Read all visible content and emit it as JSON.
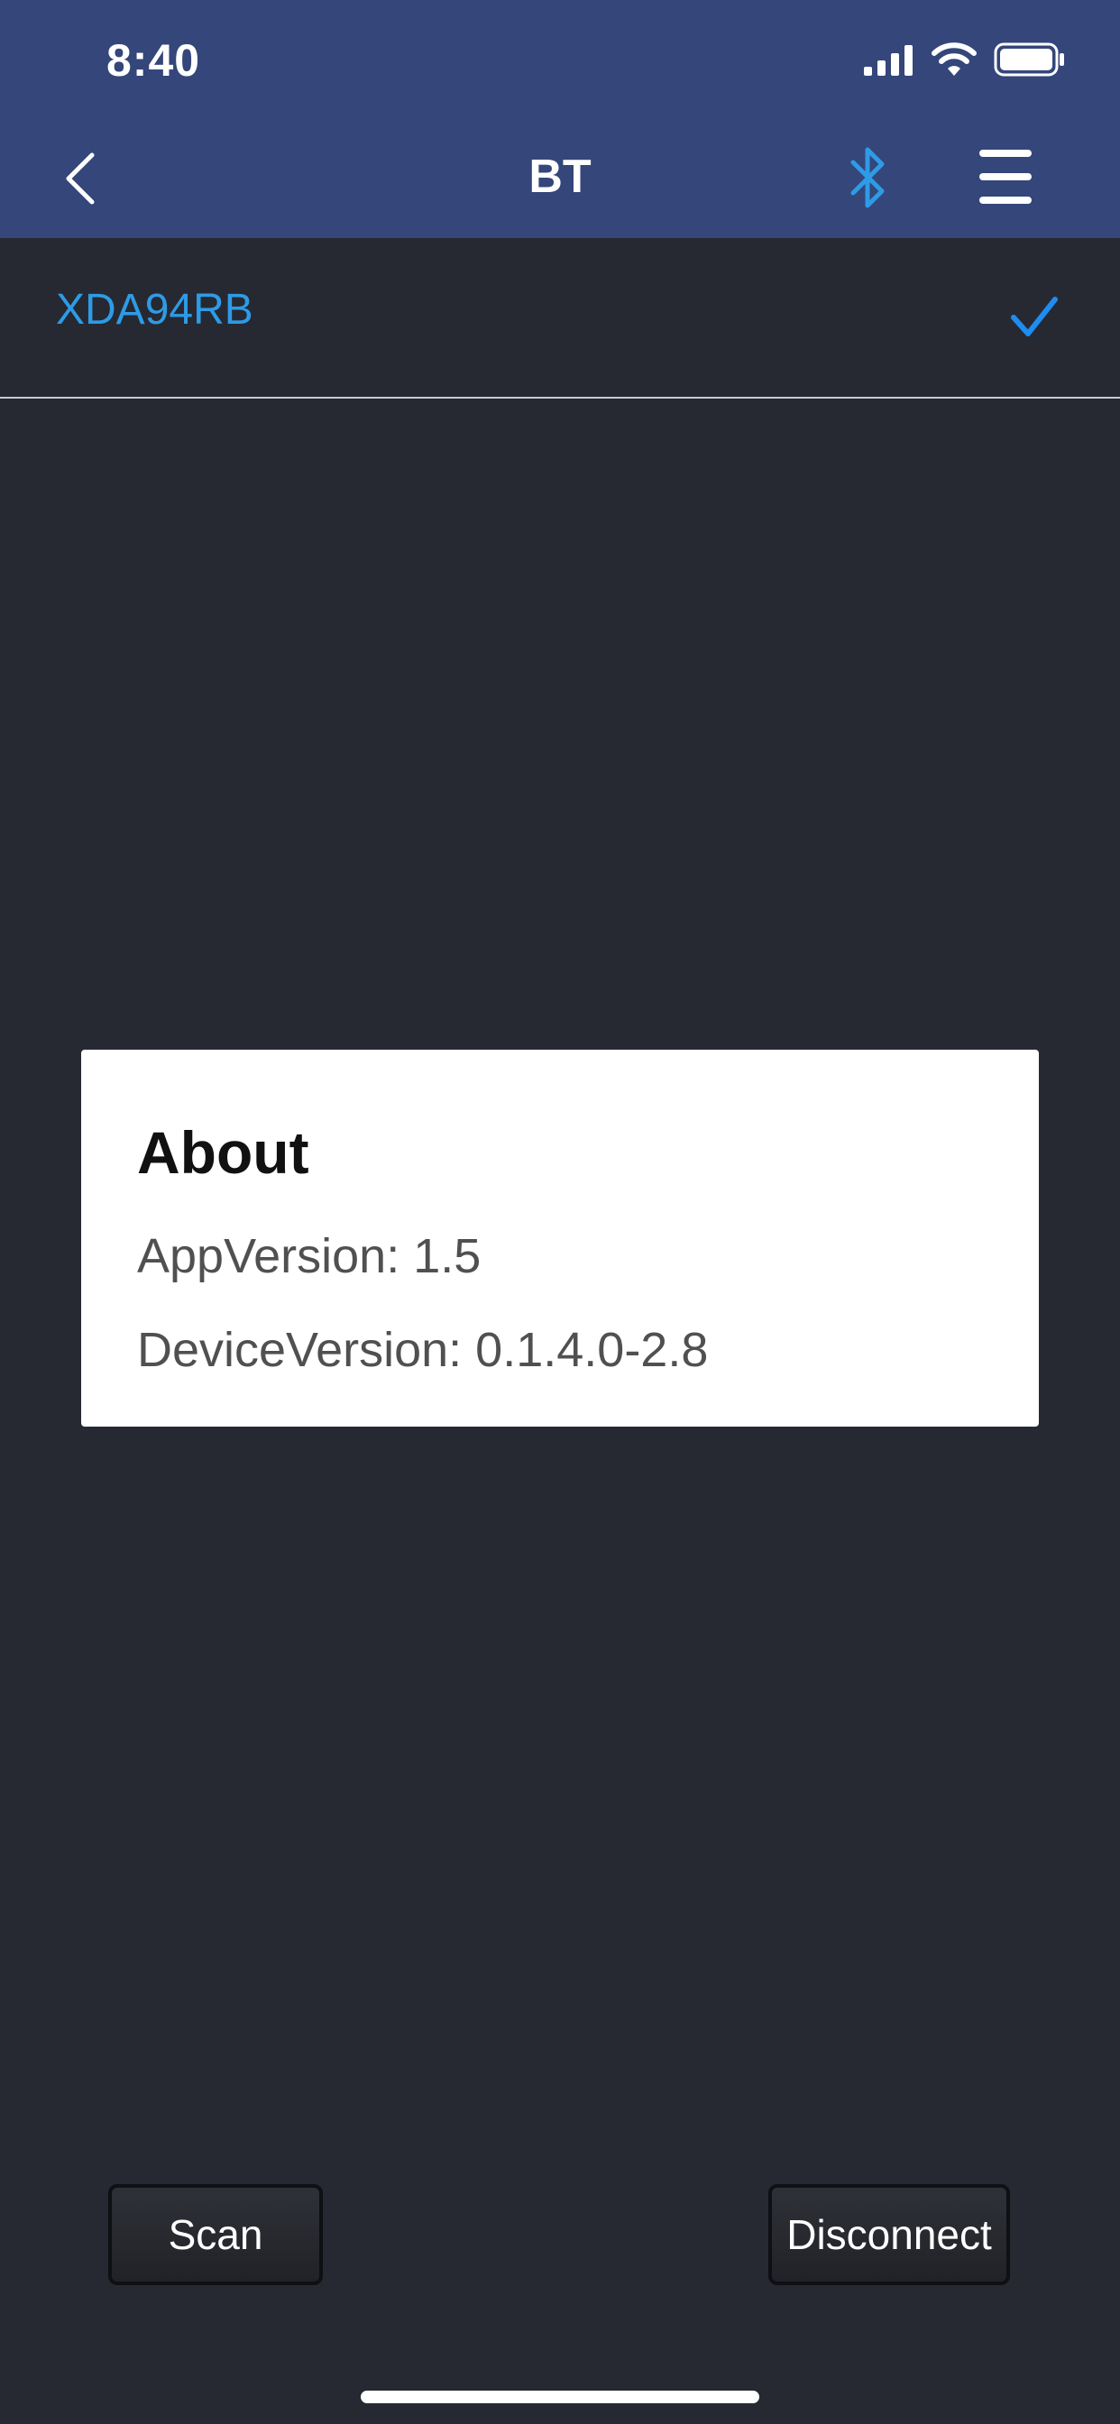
{
  "status_bar": {
    "time": "8:40"
  },
  "nav": {
    "title": "BT",
    "back_icon": "chevron-left-icon",
    "bluetooth_icon": "bluetooth-icon",
    "menu_icon": "hamburger-menu-icon"
  },
  "devices": [
    {
      "name": "XDA94RB",
      "connected": true
    }
  ],
  "about": {
    "title": "About",
    "app_version": "AppVersion: 1.5",
    "device_version": "DeviceVersion: 0.1.4.0-2.8"
  },
  "actions": {
    "scan_label": "Scan",
    "disconnect_label": "Disconnect"
  },
  "colors": {
    "header": "#34467a",
    "background": "#262932",
    "accent": "#2e9be6",
    "check": "#1f8cf0"
  }
}
